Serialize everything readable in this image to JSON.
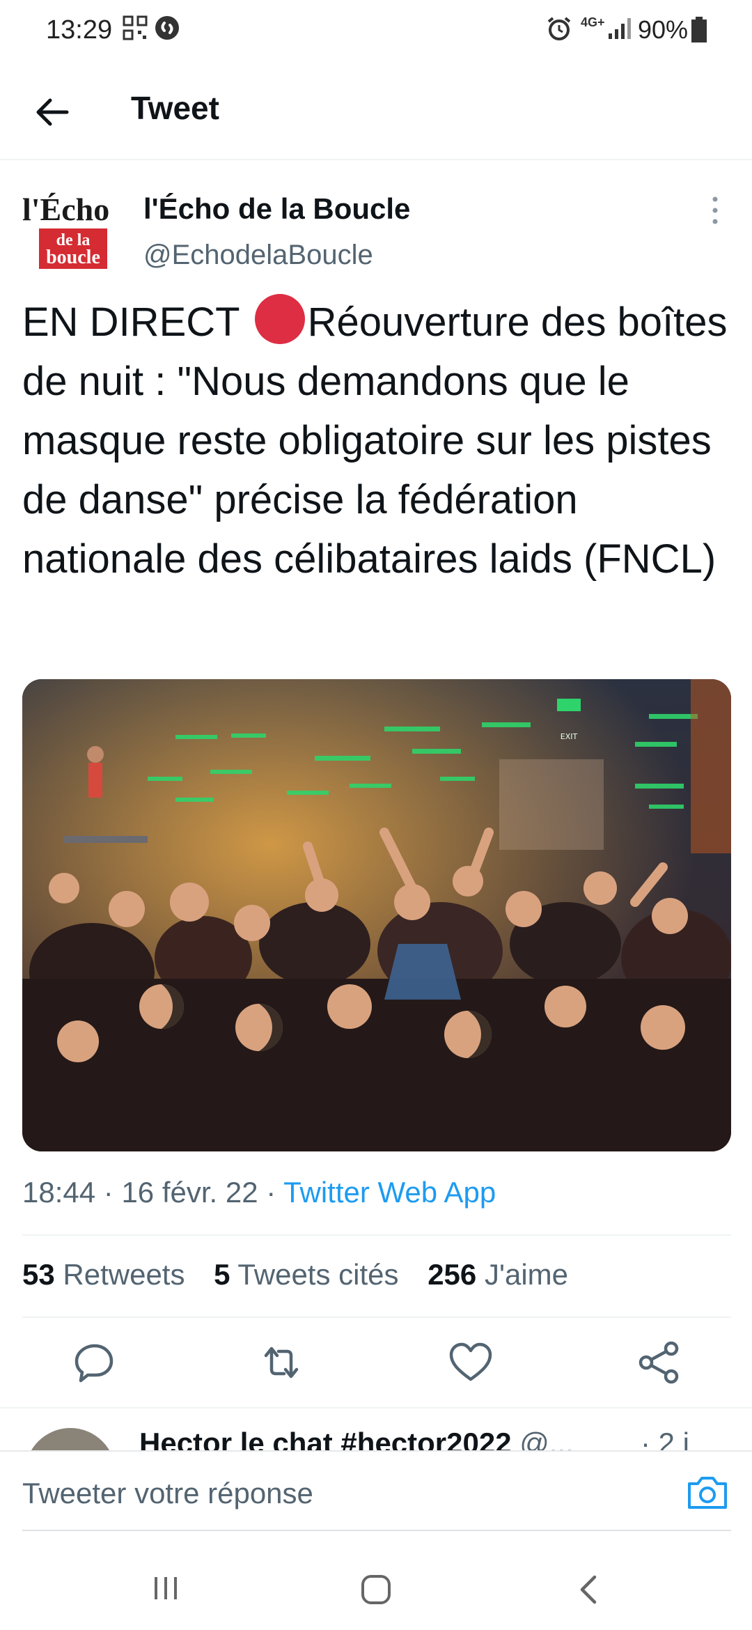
{
  "status_bar": {
    "time": "13:29",
    "network": "4G+",
    "battery": "90%"
  },
  "header": {
    "title": "Tweet"
  },
  "tweet": {
    "author_name": "l'Écho de la Boucle",
    "author_handle": "@EchodelaBoucle",
    "avatar_logo": {
      "line1": "l'Écho",
      "line2": "de la",
      "line3": "boucle"
    },
    "text_before_emoji": "EN DIRECT ",
    "text_after_emoji": "Réouverture des boîtes de nuit : \"Nous demandons que le masque reste obligatoire sur les pistes de danse\" précise la fédération nationale des célibataires laids (FNCL)",
    "time": "18:44",
    "date": "16 févr. 22",
    "source": "Twitter Web App",
    "photo_exit_sign": "EXIT",
    "stats": {
      "retweets_count": "53",
      "retweets_label": "Retweets",
      "quotes_count": "5",
      "quotes_label": "Tweets cités",
      "likes_count": "256",
      "likes_label": "J'aime"
    }
  },
  "reply_peek": {
    "name": "Hector le chat #hector2022",
    "handle": "@...",
    "time": "· 2 j"
  },
  "reply_bar": {
    "placeholder": "Tweeter votre réponse"
  },
  "icons": {
    "back": "arrow-left-icon",
    "more": "more-vertical-icon",
    "reply": "reply-icon",
    "retweet": "retweet-icon",
    "like": "heart-icon",
    "share": "share-icon",
    "camera": "camera-icon"
  },
  "colors": {
    "link": "#1d9bf0",
    "secondary_text": "#536471",
    "primary_text": "#0f1419",
    "red_dot": "#dd2e44"
  }
}
